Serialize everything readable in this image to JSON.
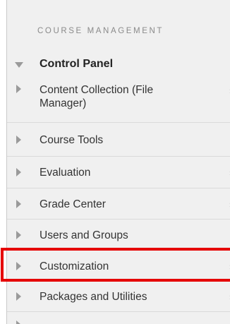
{
  "panel": {
    "section_header": "COURSE MANAGEMENT",
    "control_panel_label": "Control Panel",
    "items": [
      {
        "label": "Content Collection (File Manager)"
      },
      {
        "label": "Course Tools"
      },
      {
        "label": "Evaluation"
      },
      {
        "label": "Grade Center"
      },
      {
        "label": "Users and Groups"
      },
      {
        "label": "Customization"
      },
      {
        "label": "Packages and Utilities"
      }
    ]
  },
  "colors": {
    "panel_background": "#f0f0f0",
    "highlight_border": "#e50000",
    "arrow": "#9a9a9a"
  },
  "icons": {
    "expanded": "triangle-down-icon",
    "collapsed": "triangle-right-icon",
    "submenu": "chevron-right-icon"
  }
}
